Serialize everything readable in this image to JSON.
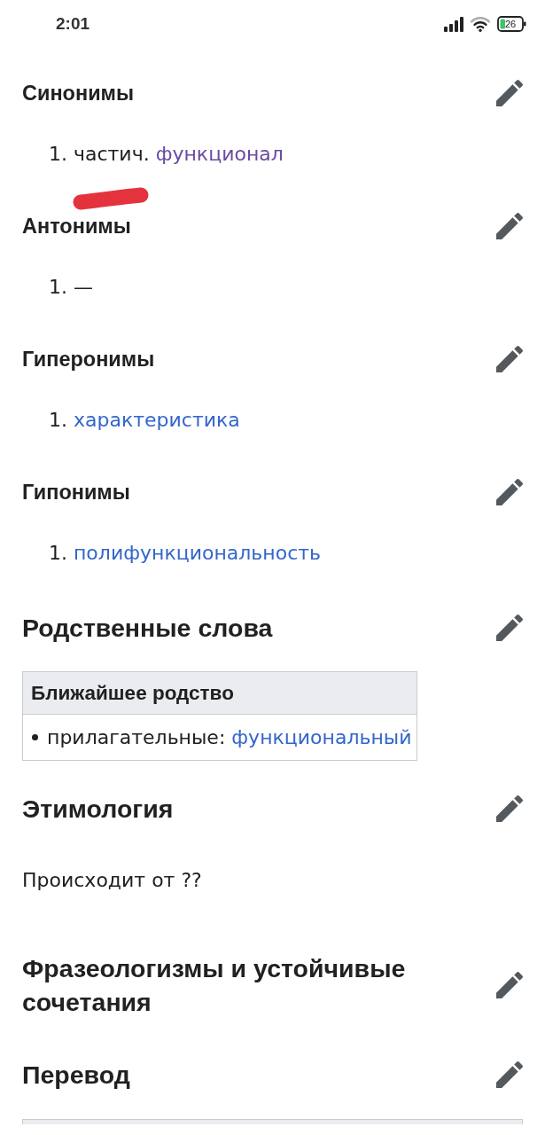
{
  "status_bar": {
    "time": "2:01",
    "battery": "26"
  },
  "sections": [
    {
      "kind": "subsection",
      "title": "Синонимы",
      "content": [
        {
          "kind": "list_item",
          "number": "1.",
          "text": "частич.",
          "link": {
            "text": "функционал",
            "visited": true
          }
        }
      ]
    },
    {
      "kind": "subsection",
      "title": "Антонимы",
      "content": [
        {
          "kind": "list_item",
          "number": "1.",
          "text": "—"
        }
      ]
    },
    {
      "kind": "subsection",
      "title": "Гиперонимы",
      "content": [
        {
          "kind": "list_item",
          "number": "1.",
          "link": {
            "text": "характеристика",
            "visited": false
          }
        }
      ]
    },
    {
      "kind": "subsection",
      "title": "Гипонимы",
      "content": [
        {
          "kind": "list_item",
          "number": "1.",
          "link": {
            "text": "полифункциональность",
            "visited": false
          }
        }
      ]
    },
    {
      "kind": "section",
      "title": "Родственные слова",
      "content": [
        {
          "kind": "table",
          "title": "Ближайшее родство",
          "rows": [
            {
              "label": "прилагательные:",
              "link": {
                "text": "функциональный",
                "visited": false
              }
            }
          ]
        }
      ]
    },
    {
      "kind": "section",
      "title": "Этимология",
      "content": [
        {
          "kind": "paragraph",
          "text": "Происходит от ??"
        }
      ]
    },
    {
      "kind": "section",
      "title": "Фразеологизмы и устойчивые сочетания"
    },
    {
      "kind": "section",
      "title": "Перевод",
      "content": [
        {
          "kind": "frame"
        }
      ]
    }
  ]
}
